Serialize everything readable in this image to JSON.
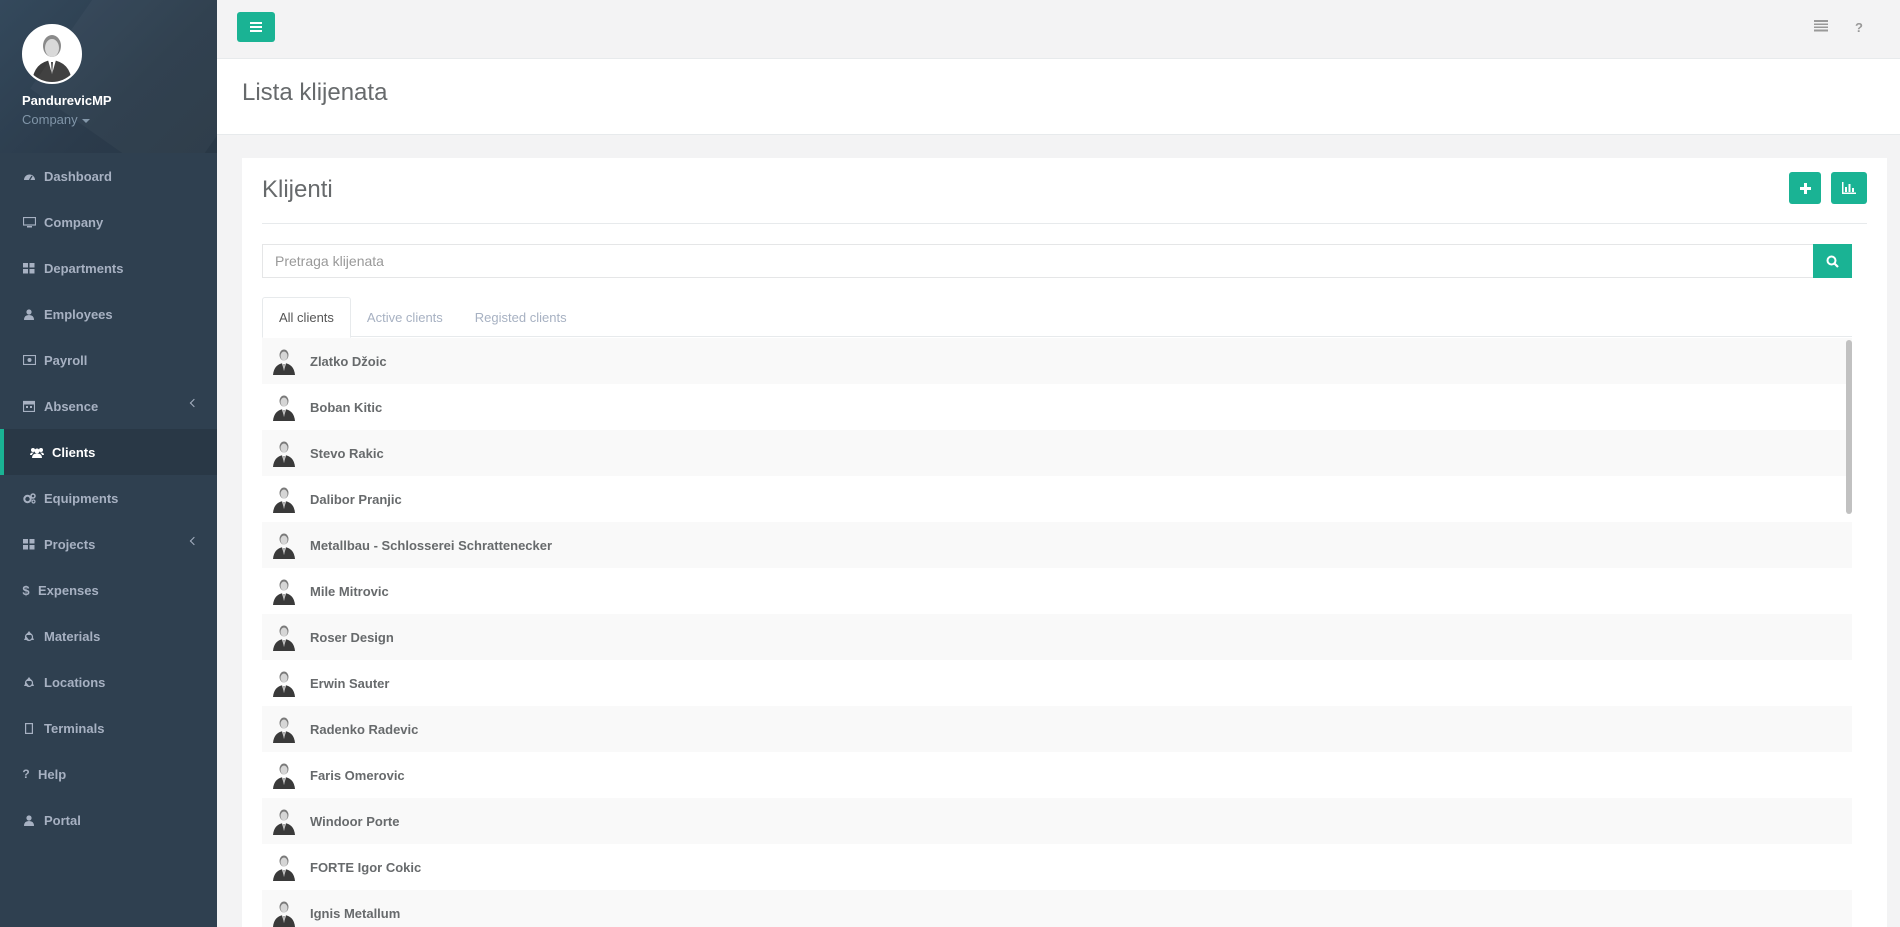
{
  "profile": {
    "name": "PandurevicMP",
    "company": "Company"
  },
  "nav": [
    {
      "label": "Dashboard",
      "icon": "dashboard-icon"
    },
    {
      "label": "Company",
      "icon": "desktop-icon"
    },
    {
      "label": "Departments",
      "icon": "grid-icon"
    },
    {
      "label": "Employees",
      "icon": "user-icon"
    },
    {
      "label": "Payroll",
      "icon": "money-icon"
    },
    {
      "label": "Absence",
      "icon": "calendar-icon",
      "has_submenu": true
    },
    {
      "label": "Clients",
      "icon": "users-icon",
      "active": true
    },
    {
      "label": "Equipments",
      "icon": "cogs-icon"
    },
    {
      "label": "Projects",
      "icon": "grid-icon",
      "has_submenu": true
    },
    {
      "label": "Expenses",
      "icon": "dollar-icon"
    },
    {
      "label": "Materials",
      "icon": "recycle-icon"
    },
    {
      "label": "Locations",
      "icon": "recycle-icon"
    },
    {
      "label": "Terminals",
      "icon": "tablet-icon"
    },
    {
      "label": "Help",
      "icon": "question-icon"
    },
    {
      "label": "Portal",
      "icon": "user-icon"
    }
  ],
  "header": {
    "title": "Lista klijenata"
  },
  "card": {
    "title": "Klijenti",
    "search_placeholder": "Pretraga klijenata",
    "tabs": [
      {
        "label": "All clients",
        "active": true
      },
      {
        "label": "Active clients"
      },
      {
        "label": "Registed clients"
      }
    ],
    "clients": [
      "Zlatko Džoic",
      "Boban Kitic",
      "Stevo Rakic",
      "Dalibor Pranjic",
      "Metallbau - Schlosserei Schrattenecker",
      "Mile Mitrovic",
      "Roser Design",
      "Erwin Sauter",
      "Radenko Radevic",
      "Faris Omerovic",
      "Windoor Porte",
      "FORTE Igor Cokic",
      "Ignis Metallum"
    ]
  },
  "colors": {
    "accent": "#1ab394",
    "sidebar": "#2f4050"
  }
}
